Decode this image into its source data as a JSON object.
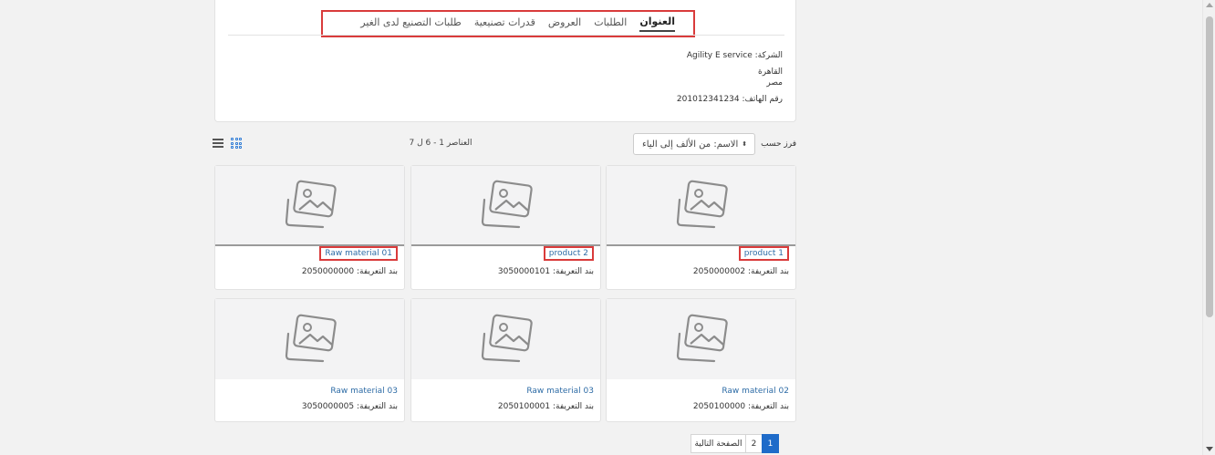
{
  "tabs": [
    {
      "label": "العنوان",
      "active": true
    },
    {
      "label": "الطلبات",
      "active": false
    },
    {
      "label": "العروض",
      "active": false
    },
    {
      "label": "قدرات تصنيعية",
      "active": false
    },
    {
      "label": "طلبات التصنيع لدى الغير",
      "active": false
    }
  ],
  "company_info": {
    "company": "الشركة: Agility E service",
    "city": "القاهرة",
    "country": "مصر",
    "phone": "رقم الهاتف: 201012341234"
  },
  "toolbar": {
    "items_count": "العناصر 1 - 6 ل 7",
    "sort_label": "فرز حسب",
    "sort_value": "الاسم: من الألف إلى الياء",
    "sort_arrows": "⬍",
    "list_icon": "list-icon",
    "grid_icon": "grid-icon"
  },
  "products": [
    {
      "name": "product 1",
      "sku": "بند التعريفة: 2050000002",
      "highlighted": true
    },
    {
      "name": "product 2",
      "sku": "بند التعريفة: 3050000101",
      "highlighted": true
    },
    {
      "name": "Raw material 01",
      "sku": "بند التعريفة: 2050000000",
      "highlighted": true
    },
    {
      "name": "Raw material 02",
      "sku": "بند التعريفة: 2050100000",
      "highlighted": false
    },
    {
      "name": "Raw material 03",
      "sku": "بند التعريفة: 2050100001",
      "highlighted": false
    },
    {
      "name": "Raw material 03",
      "sku": "بند التعريفة: 3050000005",
      "highlighted": false
    }
  ],
  "pagination": {
    "pages": [
      "1",
      "2"
    ],
    "current": "1",
    "next_label": "الصفحة التالية"
  },
  "colors": {
    "highlight": "#d93b3b",
    "link": "#2e6ca6",
    "active_page": "#1e6bc9"
  }
}
